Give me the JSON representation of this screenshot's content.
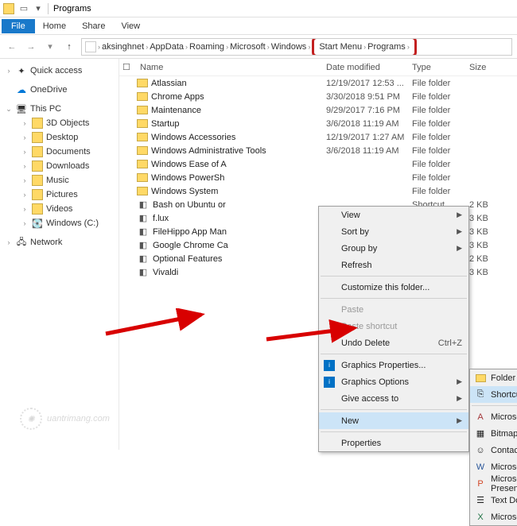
{
  "title": "Programs",
  "menubar": {
    "file": "File",
    "home": "Home",
    "share": "Share",
    "view": "View"
  },
  "breadcrumbs": [
    "aksinghnet",
    "AppData",
    "Roaming",
    "Microsoft",
    "Windows",
    "Start Menu",
    "Programs"
  ],
  "sidebar": {
    "quick": "Quick access",
    "onedrive": "OneDrive",
    "thispc": "This PC",
    "pc_items": [
      "3D Objects",
      "Desktop",
      "Documents",
      "Downloads",
      "Music",
      "Pictures",
      "Videos",
      "Windows (C:)"
    ],
    "network": "Network"
  },
  "columns": {
    "name": "Name",
    "date": "Date modified",
    "type": "Type",
    "size": "Size"
  },
  "files": [
    {
      "name": "Atlassian",
      "date": "12/19/2017 12:53 ...",
      "type": "File folder",
      "size": "",
      "icon": "folder"
    },
    {
      "name": "Chrome Apps",
      "date": "3/30/2018 9:51 PM",
      "type": "File folder",
      "size": "",
      "icon": "folder"
    },
    {
      "name": "Maintenance",
      "date": "9/29/2017 7:16 PM",
      "type": "File folder",
      "size": "",
      "icon": "folder"
    },
    {
      "name": "Startup",
      "date": "3/6/2018 11:19 AM",
      "type": "File folder",
      "size": "",
      "icon": "folder"
    },
    {
      "name": "Windows Accessories",
      "date": "12/19/2017 1:27 AM",
      "type": "File folder",
      "size": "",
      "icon": "folder"
    },
    {
      "name": "Windows Administrative Tools",
      "date": "3/6/2018 11:19 AM",
      "type": "File folder",
      "size": "",
      "icon": "folder"
    },
    {
      "name": "Windows Ease of A",
      "date": "",
      "type": "File folder",
      "size": "",
      "icon": "folder"
    },
    {
      "name": "Windows PowerSh",
      "date": "",
      "type": "File folder",
      "size": "",
      "icon": "folder"
    },
    {
      "name": "Windows System",
      "date": "",
      "type": "File folder",
      "size": "",
      "icon": "folder"
    },
    {
      "name": "Bash on Ubuntu or",
      "date": "",
      "type": "Shortcut",
      "size": "2 KB",
      "icon": "app"
    },
    {
      "name": "f.lux",
      "date": "",
      "type": "Shortcut",
      "size": "3 KB",
      "icon": "app"
    },
    {
      "name": "FileHippo App Man",
      "date": "",
      "type": "Shortcut",
      "size": "3 KB",
      "icon": "app"
    },
    {
      "name": "Google Chrome Ca",
      "date": "",
      "type": "Shortcut",
      "size": "3 KB",
      "icon": "app"
    },
    {
      "name": "Optional Features",
      "date": "",
      "type": "Shortcut",
      "size": "2 KB",
      "icon": "app"
    },
    {
      "name": "Vivaldi",
      "date": "",
      "type": "Shortcut",
      "size": "3 KB",
      "icon": "app"
    }
  ],
  "context1": {
    "view": "View",
    "sortby": "Sort by",
    "groupby": "Group by",
    "refresh": "Refresh",
    "customize": "Customize this folder...",
    "paste": "Paste",
    "pastesc": "Paste shortcut",
    "undo": "Undo Delete",
    "undosc": "Ctrl+Z",
    "gprops": "Graphics Properties...",
    "gopts": "Graphics Options",
    "giveaccess": "Give access to",
    "new": "New",
    "properties": "Properties"
  },
  "context2": {
    "folder": "Folder",
    "shortcut": "Shortcut",
    "access": "Microsoft Access Database",
    "bitmap": "Bitmap image",
    "contact": "Contact",
    "word": "Microsoft Word Document",
    "ppt": "Microsoft PowerPoint Presentation",
    "text": "Text Document",
    "excel": "Microsoft Excel Worksheet"
  },
  "watermark": "uantrimang.com"
}
